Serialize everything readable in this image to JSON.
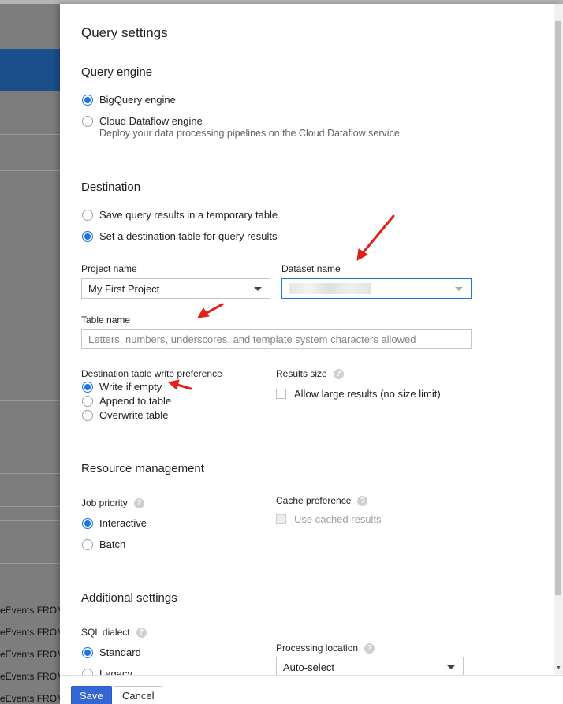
{
  "background": {
    "event_rows": [
      "eEvents FROM",
      "eEvents FROM",
      "eEvents FROM",
      "eEvents FROM",
      "eEvents FROM"
    ]
  },
  "dialog": {
    "title": "Query settings",
    "query_engine": {
      "heading": "Query engine",
      "options": [
        {
          "label": "BigQuery engine",
          "checked": true
        },
        {
          "label": "Cloud Dataflow engine",
          "checked": false,
          "description": "Deploy your data processing pipelines on the Cloud Dataflow service."
        }
      ]
    },
    "destination": {
      "heading": "Destination",
      "options": [
        {
          "label": "Save query results in a temporary table",
          "checked": false
        },
        {
          "label": "Set a destination table for query results",
          "checked": true
        }
      ],
      "project_label": "Project name",
      "project_value": "My First Project",
      "dataset_label": "Dataset name",
      "table_label": "Table name",
      "table_placeholder": "Letters, numbers, underscores, and template system characters allowed",
      "write_pref_label": "Destination table write preference",
      "write_options": [
        {
          "label": "Write if empty",
          "checked": true
        },
        {
          "label": "Append to table",
          "checked": false
        },
        {
          "label": "Overwrite table",
          "checked": false
        }
      ],
      "results_size_label": "Results size",
      "allow_large_label": "Allow large results (no size limit)"
    },
    "resource": {
      "heading": "Resource management",
      "job_priority_label": "Job priority",
      "priority_options": [
        {
          "label": "Interactive",
          "checked": true
        },
        {
          "label": "Batch",
          "checked": false
        }
      ],
      "cache_label": "Cache preference",
      "cache_option": "Use cached results"
    },
    "additional": {
      "heading": "Additional settings",
      "sql_dialect_label": "SQL dialect",
      "dialect_options": [
        {
          "label": "Standard",
          "checked": true
        },
        {
          "label": "Legacy",
          "checked": false
        }
      ],
      "processing_location_label": "Processing location",
      "processing_location_value": "Auto-select"
    },
    "help_glyph": "?",
    "footer": {
      "save": "Save",
      "cancel": "Cancel"
    }
  },
  "colors": {
    "accent": "#1a73e8",
    "primary_button": "#3367d6",
    "annotation_arrow": "#e0201b"
  }
}
